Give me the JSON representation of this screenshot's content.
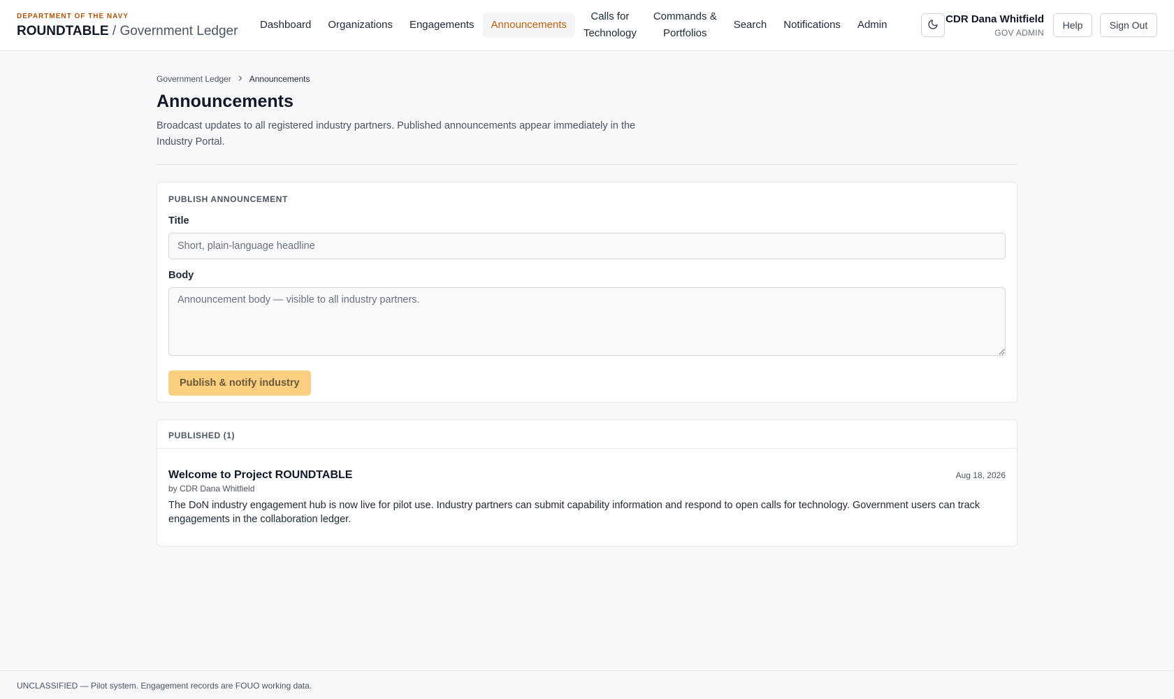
{
  "brand": {
    "dept": "DEPARTMENT OF THE NAVY",
    "name": "ROUNDTABLE",
    "separator": " / ",
    "subtitle": "Government Ledger"
  },
  "nav": {
    "items": [
      {
        "label": "Dashboard"
      },
      {
        "label": "Organizations"
      },
      {
        "label": "Engagements"
      },
      {
        "label": "Announcements",
        "active": true
      },
      {
        "line1": "Calls for",
        "line2": "Technology"
      },
      {
        "line1": "Commands &",
        "line2": "Portfolios"
      },
      {
        "label": "Search"
      },
      {
        "label": "Notifications"
      },
      {
        "label": "Admin"
      }
    ]
  },
  "header": {
    "theme_icon": "moon-icon",
    "user_name": "CDR Dana Whitfield",
    "user_role": "GOV ADMIN",
    "help_label": "Help",
    "signout_label": "Sign Out"
  },
  "breadcrumb": {
    "root": "Government Ledger",
    "separator_icon": "chevron-right-icon",
    "current": "Announcements"
  },
  "page": {
    "title": "Announcements",
    "description": "Broadcast updates to all registered industry partners. Published announcements appear immediately in the Industry Portal."
  },
  "publish_form": {
    "section_label": "PUBLISH ANNOUNCEMENT",
    "title_label": "Title",
    "title_value": "",
    "title_placeholder": "Short, plain-language headline",
    "body_label": "Body",
    "body_value": "",
    "body_placeholder": "Announcement body — visible to all industry partners.",
    "submit_label": "Publish & notify industry"
  },
  "published": {
    "section_label": "PUBLISHED (1)",
    "items": [
      {
        "title": "Welcome to Project ROUNDTABLE",
        "date": "Aug 18, 2026",
        "author": "by CDR Dana Whitfield",
        "body": "The DoN industry engagement hub is now live for pilot use. Industry partners can submit capability information and respond to open calls for technology. Government users can track engagements in the collaboration ledger."
      }
    ]
  },
  "footer": {
    "text": "UNCLASSIFIED — Pilot system. Engagement records are FOUO working data."
  },
  "colors": {
    "accent": "#c2640d",
    "dept": "#b45309",
    "publish_button_bg": "#fbcf82",
    "page_bg": "#f7f8fa"
  }
}
